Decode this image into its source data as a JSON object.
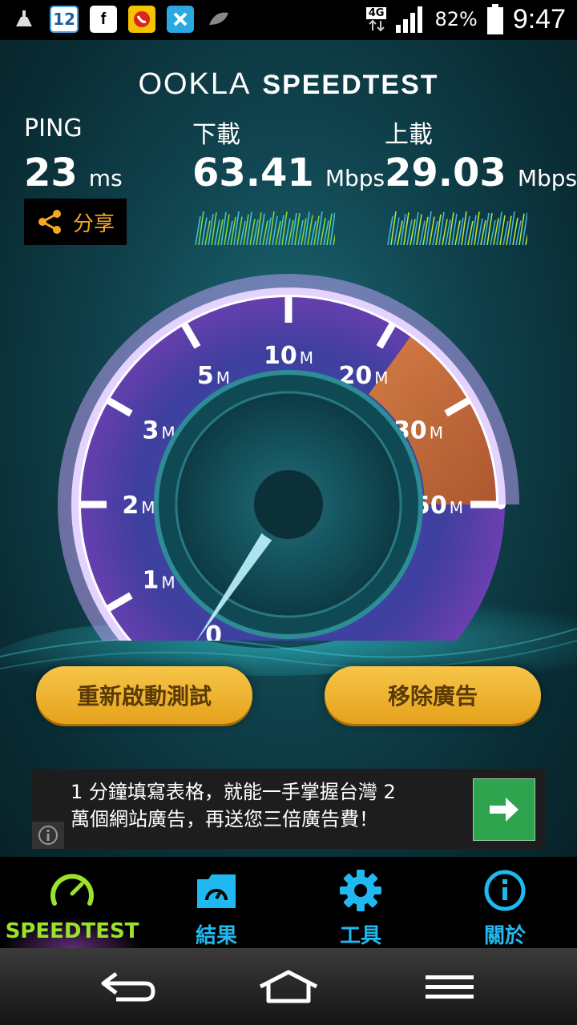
{
  "status_bar": {
    "notification_icons": [
      "clean-icon",
      "calendar-icon",
      "facebook-icon",
      "phone-app-icon",
      "game-app-icon",
      "leaf-icon"
    ],
    "calendar_day": "12",
    "network": "4G",
    "battery": "82%",
    "time": "9:47"
  },
  "header": {
    "brand": "OOKLA",
    "product": "SPEEDTEST"
  },
  "stats": {
    "ping": {
      "label": "PING",
      "value": "23",
      "unit": "ms"
    },
    "download": {
      "label": "下載",
      "value": "63.41",
      "unit": "Mbps"
    },
    "upload": {
      "label": "上載",
      "value": "29.03",
      "unit": "Mbps"
    },
    "share_label": "分享"
  },
  "gauge": {
    "ticks": [
      {
        "n": "0",
        "u": ""
      },
      {
        "n": "1",
        "u": "M"
      },
      {
        "n": "2",
        "u": "M"
      },
      {
        "n": "3",
        "u": "M"
      },
      {
        "n": "5",
        "u": "M"
      },
      {
        "n": "10",
        "u": "M"
      },
      {
        "n": "20",
        "u": "M"
      },
      {
        "n": "30",
        "u": "M"
      },
      {
        "n": "50",
        "u": "M"
      }
    ],
    "needle_value": "0"
  },
  "actions": {
    "restart_label": "重新啟動測試",
    "remove_ads_label": "移除廣告"
  },
  "ad": {
    "line1": "1 分鐘填寫表格，就能一手掌握台灣 2",
    "line2": "萬個網站廣告，再送您三倍廣告費！"
  },
  "tabs": [
    {
      "label": "SPEEDTEST",
      "icon": "speedometer-icon",
      "active": true
    },
    {
      "label": "結果",
      "icon": "results-icon",
      "active": false
    },
    {
      "label": "工具",
      "icon": "gear-icon",
      "active": false
    },
    {
      "label": "關於",
      "icon": "info-icon",
      "active": false
    }
  ],
  "nav": [
    "back-icon",
    "home-icon",
    "menu-icon"
  ],
  "colors": {
    "accent": "#20b8f0",
    "active_tab": "#9be22b",
    "button": "#f0b83a",
    "share": "#f5a623"
  }
}
